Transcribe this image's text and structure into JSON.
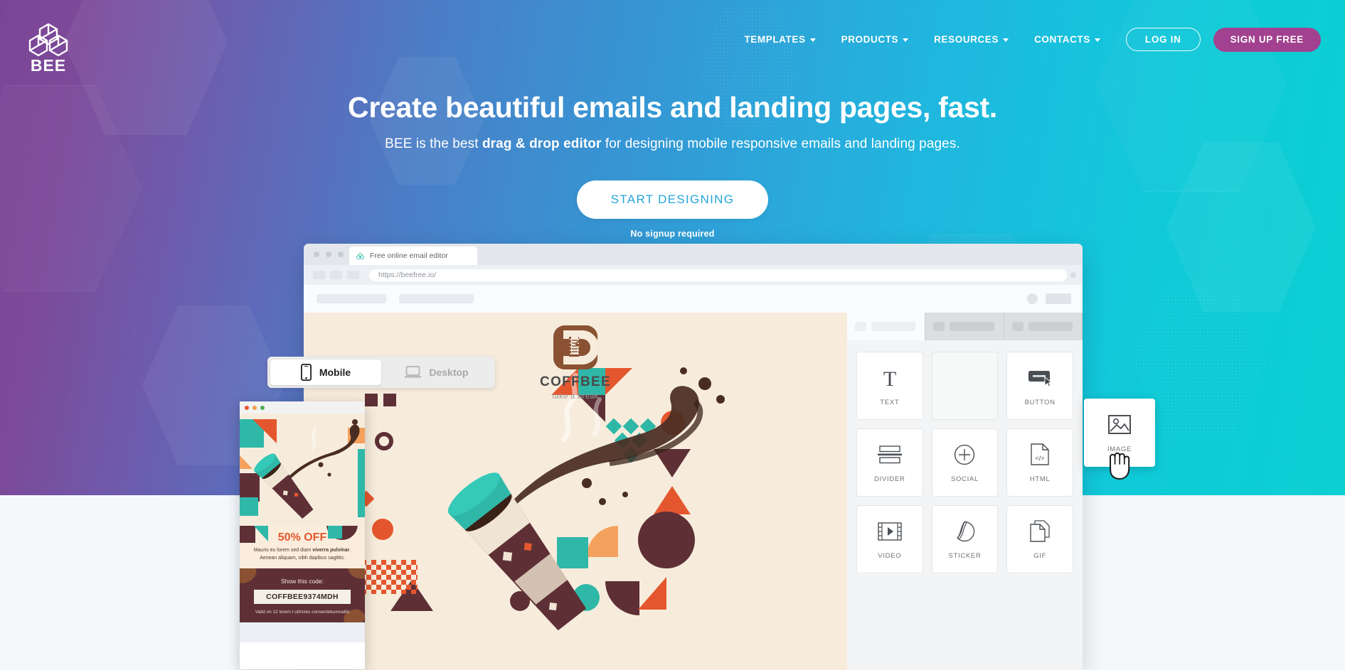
{
  "brand": {
    "logo_text": "BEE",
    "logo_icon": "bee-cubes-logo-icon"
  },
  "nav": {
    "items": [
      {
        "label": "TEMPLATES",
        "has_dropdown": true
      },
      {
        "label": "PRODUCTS",
        "has_dropdown": true
      },
      {
        "label": "RESOURCES",
        "has_dropdown": true
      },
      {
        "label": "CONTACTS",
        "has_dropdown": true
      }
    ],
    "login_label": "LOG IN",
    "signup_label": "SIGN UP FREE"
  },
  "hero": {
    "headline": "Create beautiful emails and landing pages, fast.",
    "subhead_prefix": "BEE is the best ",
    "subhead_bold": "drag & drop editor",
    "subhead_suffix": " for designing mobile responsive emails and landing pages.",
    "cta_label": "START DESIGNING",
    "cta_note": "No signup required"
  },
  "browser": {
    "tab_title": "Free online email editor",
    "tab_favicon": "bee-favicon-icon",
    "url": "https://beefree.io/"
  },
  "preview_toggle": {
    "mobile_label": "Mobile",
    "mobile_icon": "phone-icon",
    "mobile_active": true,
    "desktop_label": "Desktop",
    "desktop_icon": "laptop-icon",
    "desktop_active": false
  },
  "email_design": {
    "logo_name": "COFFBEE",
    "logo_tagline": "take a break",
    "promo_headline": "50% OFF",
    "promo_body_line1_prefix": "Mauris eu lorem sed diam ",
    "promo_body_line1_bold": "viverra pulvinar",
    "promo_body_line1_suffix": ".",
    "promo_body_line2": "Aenean aliquam, nibh dapibus sagittis.",
    "code_prompt": "Show this code:",
    "coupon_code": "COFFBEE9374MDH",
    "code_terms": "Valid on 12 lorem t ultricies consectetuonvallis"
  },
  "content_blocks": {
    "items": [
      {
        "label": "TEXT",
        "icon": "text-t-icon",
        "state": "normal"
      },
      {
        "label": "",
        "icon": "empty-slot",
        "state": "empty"
      },
      {
        "label": "BUTTON",
        "icon": "button-icon",
        "state": "normal"
      },
      {
        "label": "DIVIDER",
        "icon": "divider-icon",
        "state": "normal"
      },
      {
        "label": "SOCIAL",
        "icon": "plus-circle-icon",
        "state": "normal"
      },
      {
        "label": "HTML",
        "icon": "code-file-icon",
        "state": "normal"
      },
      {
        "label": "VIDEO",
        "icon": "film-play-icon",
        "state": "normal"
      },
      {
        "label": "STICKER",
        "icon": "sticker-icon",
        "state": "normal"
      },
      {
        "label": "GIF",
        "icon": "gif-pages-icon",
        "state": "normal"
      }
    ],
    "dragged": {
      "label": "IMAGE",
      "icon": "image-picture-icon"
    },
    "cursor": "grabbing-hand-cursor"
  },
  "colors": {
    "gradient_start": "#7b4596",
    "gradient_end": "#0bcfd2",
    "signup_button": "#a2418f",
    "cta_text": "#26a4d8",
    "promo_accent": "#e4572e",
    "coupon_bg": "#5e3036",
    "email_bg": "#f7ecdc"
  }
}
